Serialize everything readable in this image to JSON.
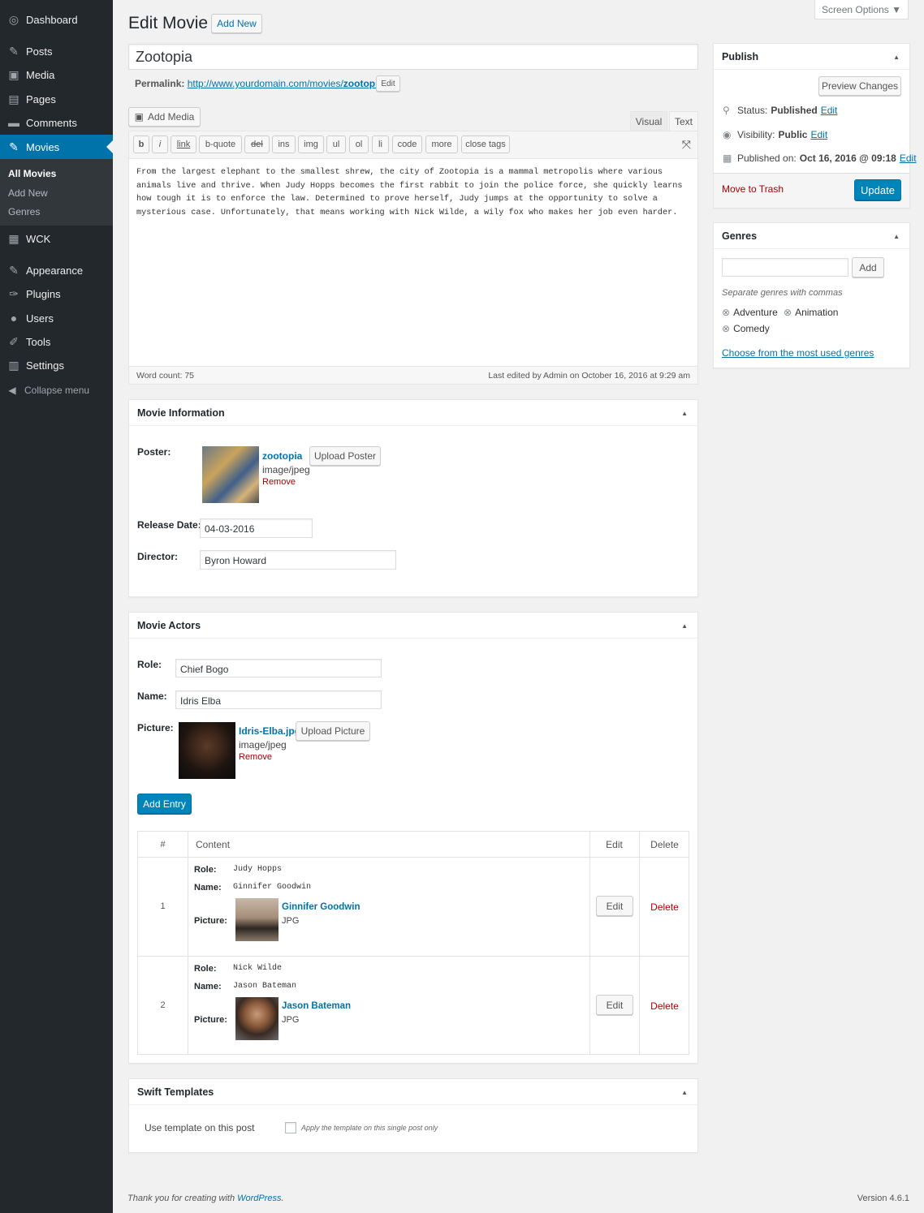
{
  "sidebar": {
    "items": [
      {
        "label": "Dashboard",
        "icon": "dashboard-icon",
        "glyph": "◎"
      },
      {
        "label": "Posts",
        "icon": "pushpin-icon",
        "glyph": "✎"
      },
      {
        "label": "Media",
        "icon": "media-icon",
        "glyph": "▣"
      },
      {
        "label": "Pages",
        "icon": "pages-icon",
        "glyph": "▤"
      },
      {
        "label": "Comments",
        "icon": "comment-icon",
        "glyph": "▬"
      },
      {
        "label": "Movies",
        "icon": "pushpin-icon",
        "glyph": "✎"
      },
      {
        "label": "WCK",
        "icon": "wck-icon",
        "glyph": "▦"
      },
      {
        "label": "Appearance",
        "icon": "brush-icon",
        "glyph": "✎"
      },
      {
        "label": "Plugins",
        "icon": "plugin-icon",
        "glyph": "✑"
      },
      {
        "label": "Users",
        "icon": "users-icon",
        "glyph": "●"
      },
      {
        "label": "Tools",
        "icon": "wrench-icon",
        "glyph": "✐"
      },
      {
        "label": "Settings",
        "icon": "settings-icon",
        "glyph": "▥"
      }
    ],
    "submenu": [
      "All Movies",
      "Add New",
      "Genres"
    ],
    "collapse": "Collapse menu",
    "collapse_glyph": "◀"
  },
  "header": {
    "title": "Edit Movie",
    "add_new": "Add New",
    "screen_options": "Screen Options ▼"
  },
  "post": {
    "title": "Zootopia",
    "permalink_label": "Permalink:",
    "permalink_base": "http://www.yourdomain.com/movies/",
    "permalink_slug": "zootopia",
    "permalink_end": "/",
    "permalink_edit": "Edit"
  },
  "editor": {
    "add_media": "Add Media",
    "tab_visual": "Visual",
    "tab_text": "Text",
    "quicktags": [
      "b",
      "i",
      "link",
      "b-quote",
      "del",
      "ins",
      "img",
      "ul",
      "ol",
      "li",
      "code",
      "more",
      "close tags"
    ],
    "content": "From the largest elephant to the smallest shrew, the city of Zootopia is a mammal metropolis where various animals live and thrive. When Judy Hopps becomes the first rabbit to join the police force, she quickly learns how tough it is to enforce the law. Determined to prove herself, Judy jumps at the opportunity to solve a mysterious case. Unfortunately, that means working with Nick Wilde, a wily fox who makes her job even harder.",
    "word_count": "Word count: 75",
    "last_edited": "Last edited by Admin on October 16, 2016 at 9:29 am"
  },
  "movie_info": {
    "title": "Movie Information",
    "poster_label": "Poster:",
    "poster_name": "zootopia",
    "poster_type": "image/jpeg",
    "poster_remove": "Remove",
    "upload_poster": "Upload Poster",
    "release_label": "Release Date:",
    "release_value": "04-03-2016",
    "director_label": "Director:",
    "director_value": "Byron Howard"
  },
  "actors": {
    "title": "Movie Actors",
    "role_label": "Role:",
    "role_value": "Chief Bogo",
    "name_label": "Name:",
    "name_value": "Idris Elba",
    "picture_label": "Picture:",
    "picture_name": "Idris-Elba.jpg",
    "picture_type": "image/jpeg",
    "picture_remove": "Remove",
    "upload_picture": "Upload Picture",
    "add_entry": "Add Entry",
    "table_headers": [
      "#",
      "Content",
      "Edit",
      "Delete"
    ],
    "rows": [
      {
        "num": "1",
        "role_label": "Role:",
        "role": "Judy Hopps",
        "name_label": "Name:",
        "name": "Ginnifer Goodwin",
        "picture_label": "Picture:",
        "picture_name": "Ginnifer Goodwin",
        "picture_type": "JPG",
        "edit": "Edit",
        "delete": "Delete"
      },
      {
        "num": "2",
        "role_label": "Role:",
        "role": "Nick Wilde",
        "name_label": "Name:",
        "name": "Jason Bateman",
        "picture_label": "Picture:",
        "picture_name": "Jason Bateman",
        "picture_type": "JPG",
        "edit": "Edit",
        "delete": "Delete"
      }
    ]
  },
  "swift": {
    "title": "Swift Templates",
    "label": "Use template on this post",
    "checkbox": "Apply the template on this single post only"
  },
  "publish": {
    "title": "Publish",
    "preview": "Preview Changes",
    "status_label": "Status:",
    "status_value": "Published",
    "status_edit": "Edit",
    "visibility_label": "Visibility:",
    "visibility_value": "Public",
    "visibility_edit": "Edit",
    "published_label": "Published on:",
    "published_value": "Oct 16, 2016 @ 09:18",
    "published_edit": "Edit",
    "trash": "Move to Trash",
    "update": "Update"
  },
  "genres": {
    "title": "Genres",
    "add": "Add",
    "hint": "Separate genres with commas",
    "tags": [
      "Adventure",
      "Animation",
      "Comedy"
    ],
    "choose": "Choose from the most used genres"
  },
  "footer": {
    "thanks": "Thank you for creating with ",
    "wp": "WordPress",
    "dot": ".",
    "version": "Version 4.6.1"
  },
  "colors": {
    "accent": "#0073aa",
    "sidebar": "#23282d",
    "danger": "#a00"
  }
}
